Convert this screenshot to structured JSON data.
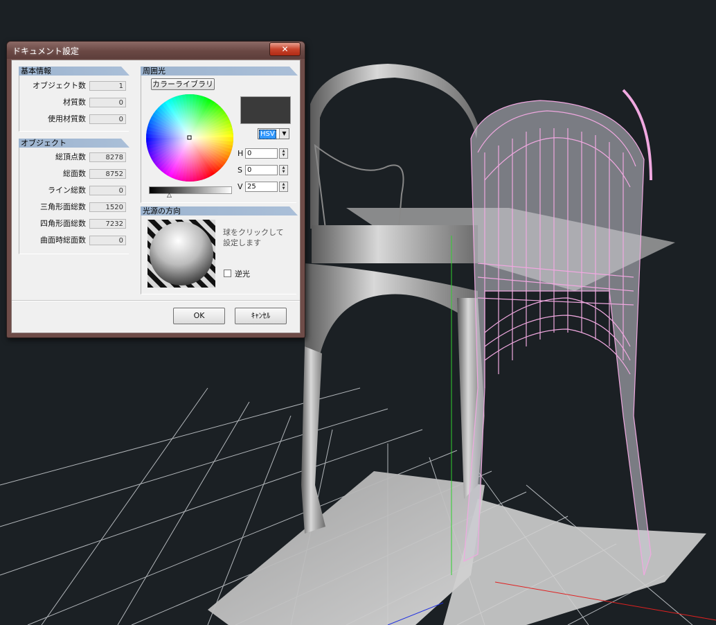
{
  "dialog": {
    "title": "ドキュメント設定",
    "close_label": "✕",
    "basic_info": {
      "header": "基本情報",
      "rows": [
        {
          "label": "オブジェクト数",
          "value": "1"
        },
        {
          "label": "材質数",
          "value": "0"
        },
        {
          "label": "使用材質数",
          "value": "0"
        }
      ]
    },
    "object": {
      "header": "オブジェクト",
      "rows": [
        {
          "label": "総頂点数",
          "value": "8278"
        },
        {
          "label": "総面数",
          "value": "8752"
        },
        {
          "label": "ライン総数",
          "value": "0"
        },
        {
          "label": "三角形面総数",
          "value": "1520"
        },
        {
          "label": "四角形面総数",
          "value": "7232"
        },
        {
          "label": "曲面時総面数",
          "value": "0"
        }
      ]
    },
    "ambient": {
      "header": "周囲光",
      "library_button": "カラーライブラリ",
      "swatch_color": "#3a3a3a",
      "mode": "HSV",
      "h_label": "H",
      "h_value": "0",
      "s_label": "S",
      "s_value": "0",
      "v_label": "V",
      "v_value": "25"
    },
    "light": {
      "header": "光源の方向",
      "hint": "球をクリックして\n設定します",
      "backlight_label": "逆光",
      "backlight_checked": false
    },
    "ok_label": "OK",
    "cancel_label": "ｷｬﾝｾﾙ"
  }
}
